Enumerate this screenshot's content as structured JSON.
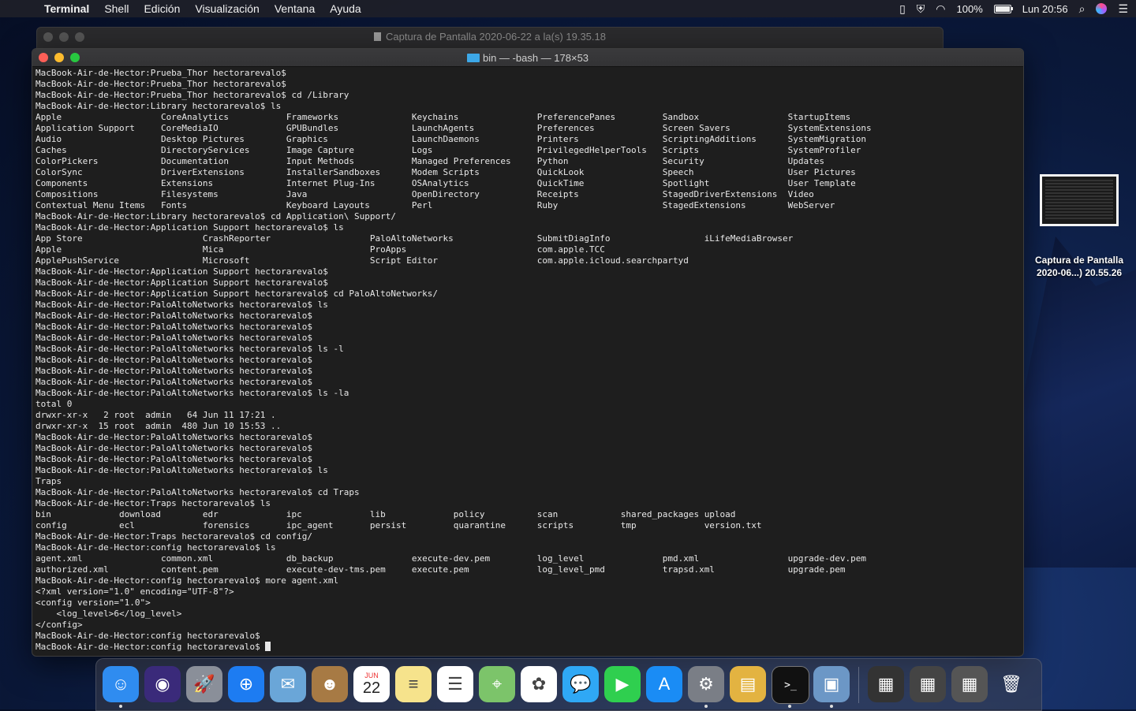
{
  "menubar": {
    "app_name": "Terminal",
    "items": [
      "Shell",
      "Edición",
      "Visualización",
      "Ventana",
      "Ayuda"
    ],
    "battery": "100%",
    "clock": "Lun 20:56"
  },
  "background_window": {
    "title": "Captura de Pantalla 2020-06-22 a la(s) 19.35.18"
  },
  "terminal": {
    "title": "bin — -bash — 178×53",
    "lines": [
      "MacBook-Air-de-Hector:Prueba_Thor hectorarevalo$",
      "MacBook-Air-de-Hector:Prueba_Thor hectorarevalo$",
      "MacBook-Air-de-Hector:Prueba_Thor hectorarevalo$ cd /Library",
      "MacBook-Air-de-Hector:Library hectorarevalo$ ls",
      "Apple                   CoreAnalytics           Frameworks              Keychains               PreferencePanes         Sandbox                 StartupItems",
      "Application Support     CoreMediaIO             GPUBundles              LaunchAgents            Preferences             Screen Savers           SystemExtensions",
      "Audio                   Desktop Pictures        Graphics                LaunchDaemons           Printers                ScriptingAdditions      SystemMigration",
      "Caches                  DirectoryServices       Image Capture           Logs                    PrivilegedHelperTools   Scripts                 SystemProfiler",
      "ColorPickers            Documentation           Input Methods           Managed Preferences     Python                  Security                Updates",
      "ColorSync               DriverExtensions        InstallerSandboxes      Modem Scripts           QuickLook               Speech                  User Pictures",
      "Components              Extensions              Internet Plug-Ins       OSAnalytics             QuickTime               Spotlight               User Template",
      "Compositions            Filesystems             Java                    OpenDirectory           Receipts                StagedDriverExtensions  Video",
      "Contextual Menu Items   Fonts                   Keyboard Layouts        Perl                    Ruby                    StagedExtensions        WebServer",
      "MacBook-Air-de-Hector:Library hectorarevalo$ cd Application\\ Support/",
      "MacBook-Air-de-Hector:Application Support hectorarevalo$ ls",
      "App Store                       CrashReporter                   PaloAltoNetworks                SubmitDiagInfo                  iLifeMediaBrowser",
      "Apple                           Mica                            ProApps                         com.apple.TCC",
      "ApplePushService                Microsoft                       Script Editor                   com.apple.icloud.searchpartyd",
      "MacBook-Air-de-Hector:Application Support hectorarevalo$",
      "MacBook-Air-de-Hector:Application Support hectorarevalo$",
      "MacBook-Air-de-Hector:Application Support hectorarevalo$ cd PaloAltoNetworks/",
      "MacBook-Air-de-Hector:PaloAltoNetworks hectorarevalo$ ls",
      "MacBook-Air-de-Hector:PaloAltoNetworks hectorarevalo$",
      "MacBook-Air-de-Hector:PaloAltoNetworks hectorarevalo$",
      "MacBook-Air-de-Hector:PaloAltoNetworks hectorarevalo$",
      "MacBook-Air-de-Hector:PaloAltoNetworks hectorarevalo$ ls -l",
      "MacBook-Air-de-Hector:PaloAltoNetworks hectorarevalo$",
      "MacBook-Air-de-Hector:PaloAltoNetworks hectorarevalo$",
      "MacBook-Air-de-Hector:PaloAltoNetworks hectorarevalo$",
      "MacBook-Air-de-Hector:PaloAltoNetworks hectorarevalo$ ls -la",
      "total 0",
      "drwxr-xr-x   2 root  admin   64 Jun 11 17:21 .",
      "drwxr-xr-x  15 root  admin  480 Jun 10 15:53 ..",
      "MacBook-Air-de-Hector:PaloAltoNetworks hectorarevalo$",
      "MacBook-Air-de-Hector:PaloAltoNetworks hectorarevalo$",
      "MacBook-Air-de-Hector:PaloAltoNetworks hectorarevalo$",
      "MacBook-Air-de-Hector:PaloAltoNetworks hectorarevalo$ ls",
      "Traps",
      "MacBook-Air-de-Hector:PaloAltoNetworks hectorarevalo$ cd Traps",
      "MacBook-Air-de-Hector:Traps hectorarevalo$ ls",
      "bin             download        edr             ipc             lib             policy          scan            shared_packages upload",
      "config          ecl             forensics       ipc_agent       persist         quarantine      scripts         tmp             version.txt",
      "MacBook-Air-de-Hector:Traps hectorarevalo$ cd config/",
      "MacBook-Air-de-Hector:config hectorarevalo$ ls",
      "agent.xml               common.xml              db_backup               execute-dev.pem         log_level               pmd.xml                 upgrade-dev.pem",
      "authorized.xml          content.pem             execute-dev-tms.pem     execute.pem             log_level_pmd           trapsd.xml              upgrade.pem",
      "MacBook-Air-de-Hector:config hectorarevalo$ more agent.xml",
      "<?xml version=\"1.0\" encoding=\"UTF-8\"?>",
      "<config version=\"1.0\">",
      "    <log_level>6</log_level>",
      "</config>",
      "MacBook-Air-de-Hector:config hectorarevalo$",
      "MacBook-Air-de-Hector:config hectorarevalo$ "
    ]
  },
  "desktop_file": {
    "label_line1": "Captura de Pantalla",
    "label_line2": "2020-06...) 20.55.26"
  },
  "dock": {
    "calendar_month": "JUN",
    "calendar_day": "22",
    "items": [
      {
        "name": "finder",
        "glyph": "☺",
        "bg": "#2f8cf0",
        "running": true
      },
      {
        "name": "siri",
        "glyph": "◉",
        "bg": "#3a2a7a",
        "running": false
      },
      {
        "name": "launchpad",
        "glyph": "🚀",
        "bg": "#8a8f99",
        "running": false
      },
      {
        "name": "safari",
        "glyph": "⊕",
        "bg": "#1d7cf2",
        "running": false
      },
      {
        "name": "mail",
        "glyph": "✉",
        "bg": "#6aa6d8",
        "running": false
      },
      {
        "name": "contacts",
        "glyph": "☻",
        "bg": "#a77a44",
        "running": false
      },
      {
        "name": "calendar",
        "glyph": "",
        "bg": "#ffffff",
        "running": false
      },
      {
        "name": "notes",
        "glyph": "≡",
        "bg": "#f6e38c",
        "running": false
      },
      {
        "name": "reminders",
        "glyph": "☰",
        "bg": "#ffffff",
        "running": false
      },
      {
        "name": "maps",
        "glyph": "⌖",
        "bg": "#7cc46a",
        "running": false
      },
      {
        "name": "photos",
        "glyph": "✿",
        "bg": "#ffffff",
        "running": false
      },
      {
        "name": "messages",
        "glyph": "💬",
        "bg": "#2fa8f5",
        "running": false
      },
      {
        "name": "facetime",
        "glyph": "▶",
        "bg": "#2fcf4f",
        "running": false
      },
      {
        "name": "app-store",
        "glyph": "A",
        "bg": "#1a8cf5",
        "running": false
      },
      {
        "name": "system-preferences",
        "glyph": "⚙",
        "bg": "#7a7e86",
        "running": true
      },
      {
        "name": "archive-utility",
        "glyph": "▤",
        "bg": "#e3b341",
        "running": false
      },
      {
        "name": "terminal",
        "glyph": ">_",
        "bg": "#111111",
        "running": true
      },
      {
        "name": "preview",
        "glyph": "▣",
        "bg": "#6c97c6",
        "running": true
      }
    ],
    "recent_items": [
      {
        "name": "recent-screenshot-1",
        "glyph": "▦",
        "bg": "#333"
      },
      {
        "name": "recent-screenshot-2",
        "glyph": "▦",
        "bg": "#444"
      },
      {
        "name": "recent-screenshot-3",
        "glyph": "▦",
        "bg": "#555"
      },
      {
        "name": "trash",
        "glyph": "🗑",
        "bg": "transparent"
      }
    ]
  }
}
